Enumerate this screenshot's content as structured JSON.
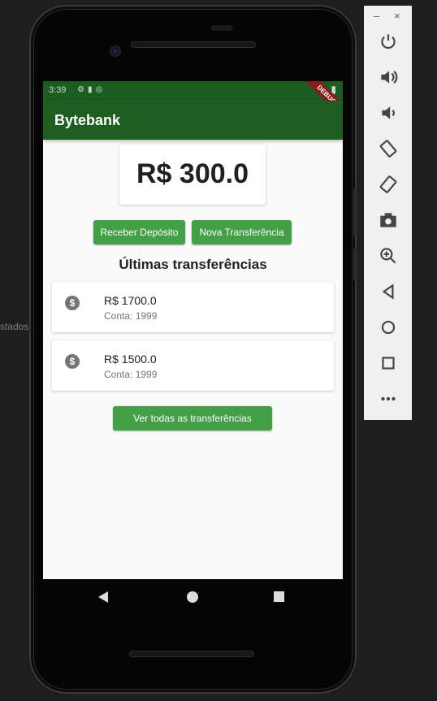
{
  "background": {
    "side_text": "stados"
  },
  "status_bar": {
    "time": "3:39",
    "debug_label": "DEBUG"
  },
  "app_bar": {
    "title": "Bytebank"
  },
  "balance": {
    "value": "R$ 300.0"
  },
  "actions": {
    "receive_label": "Receber Depósito",
    "transfer_label": "Nova Transferência"
  },
  "section": {
    "title": "Últimas transferências"
  },
  "transfers": [
    {
      "value": "R$ 1700.0",
      "account": "Conta: 1999"
    },
    {
      "value": "R$ 1500.0",
      "account": "Conta: 1999"
    }
  ],
  "see_all_label": "Ver todas as transferências",
  "colors": {
    "app_bar": "#1e5e21",
    "status_bar": "#1b5e20",
    "button": "#43a047",
    "debug_banner": "#8b1a1a"
  },
  "toolbar": {
    "minimize": "–",
    "close": "×",
    "icons": [
      "power-icon",
      "volume-up-icon",
      "volume-down-icon",
      "rotate-left-icon",
      "rotate-right-icon",
      "camera-icon",
      "zoom-icon",
      "back-icon",
      "home-icon",
      "overview-icon",
      "more-icon"
    ]
  }
}
